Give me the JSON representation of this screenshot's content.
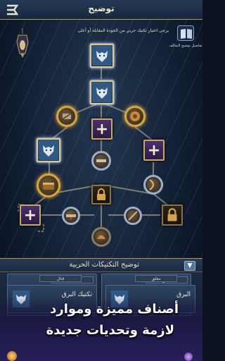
{
  "header": {
    "title": "توضيح"
  },
  "help": {
    "label": "تفاصيل توضيح التحالف"
  },
  "instruction": "يرجى اختيار تكتيك حربي من الجودة المقابلة أو أعلى",
  "tree": {
    "nodes": [
      {
        "kind": "wolf-square",
        "state": "unlocked"
      },
      {
        "kind": "wolf-square",
        "state": "unlocked"
      },
      {
        "kind": "circle",
        "state": "active"
      },
      {
        "kind": "plus-square",
        "state": "empty"
      },
      {
        "kind": "circle",
        "state": "active"
      },
      {
        "kind": "wolf-square",
        "state": "unlocked"
      },
      {
        "kind": "circle",
        "state": "item"
      },
      {
        "kind": "plus-square",
        "state": "empty"
      },
      {
        "kind": "circle",
        "state": "active"
      },
      {
        "kind": "lock-square",
        "state": "locked"
      },
      {
        "kind": "circle",
        "state": "active"
      },
      {
        "kind": "plus-square",
        "state": "empty"
      },
      {
        "kind": "circle",
        "state": "item"
      },
      {
        "kind": "circle",
        "state": "item"
      },
      {
        "kind": "lock-square",
        "state": "locked"
      },
      {
        "kind": "circle",
        "state": "item"
      }
    ]
  },
  "panel": {
    "title": "توضيح التكتيكات الحربية",
    "collapse_icon": "chevron-down-icon",
    "cards": [
      {
        "tag": "قتال",
        "name": "تكتيك البرق"
      },
      {
        "tag": "مغلق",
        "name": "البرق"
      }
    ],
    "top_tags": [
      "قتال",
      "مغلق"
    ]
  },
  "promo": {
    "line1": "أصناف مميزة وموارد",
    "line2": "لازمة وتحديات جديدة"
  },
  "colors": {
    "accent_gold": "#c9a860",
    "header_bg": "#1f324c",
    "promo_purple": "#2c1f6a"
  }
}
